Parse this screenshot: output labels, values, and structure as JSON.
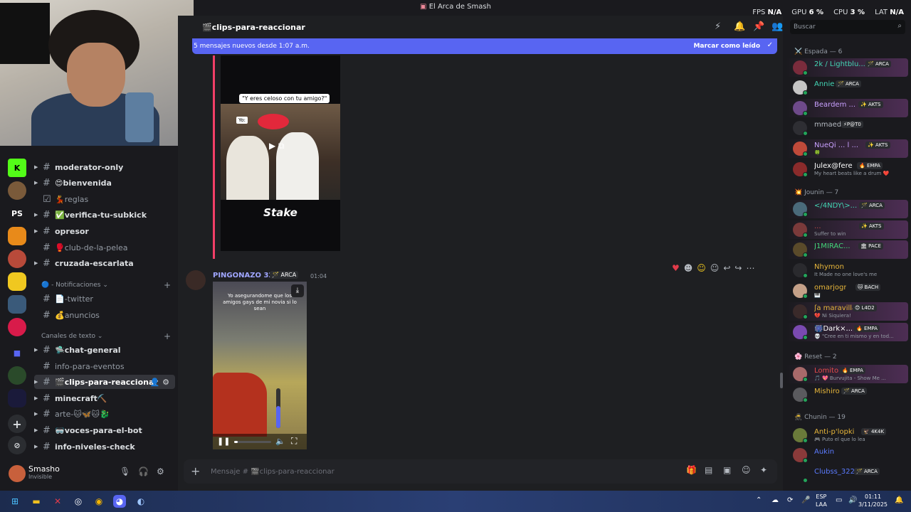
{
  "window": {
    "title": "El Arca de Smash",
    "title_icon": "server-icon"
  },
  "stats": {
    "fps_label": "FPS",
    "fps_value": "N/A",
    "gpu_label": "GPU",
    "gpu_value": "6 %",
    "cpu_label": "CPU",
    "cpu_value": "3 %",
    "lat_label": "LAT",
    "lat_value": "N/A"
  },
  "servers": [
    "K",
    "PS"
  ],
  "channels": [
    {
      "name": "moderator-only",
      "muted": false,
      "arrow": true
    },
    {
      "name": "😍bienvenida",
      "muted": false,
      "arrow": true
    },
    {
      "name": "💃reglas",
      "muted": true,
      "arrow": false,
      "icon": "rules"
    },
    {
      "name": "✅verifica-tu-subkick",
      "muted": false,
      "arrow": true
    },
    {
      "name": "opresor",
      "muted": false,
      "arrow": true
    },
    {
      "name": "🥊club-de-la-pelea",
      "muted": true,
      "arrow": false
    },
    {
      "name": "cruzada-escarlata",
      "muted": false,
      "arrow": true
    }
  ],
  "category_notifs": "🔵 - Notificaciones",
  "channels2": [
    {
      "name": "📄-twitter",
      "muted": true
    },
    {
      "name": "💰anuncios",
      "muted": true
    }
  ],
  "category_text": "Canales de texto",
  "channels3": [
    {
      "name": "🛸chat-general",
      "muted": false,
      "arrow": true
    },
    {
      "name": "info-para-eventos",
      "muted": true,
      "arrow": false
    },
    {
      "name": "🎬clips-para-reaccionar",
      "muted": false,
      "arrow": true,
      "selected": true
    },
    {
      "name": "minecraft⛏️",
      "muted": false,
      "arrow": true
    },
    {
      "name": "arte-🐱🦋🐱🐉",
      "muted": true,
      "arrow": true
    },
    {
      "name": "🥽voces-para-el-bot",
      "muted": false,
      "arrow": true
    },
    {
      "name": "info-niveles-check",
      "muted": false,
      "arrow": true
    }
  ],
  "user": {
    "name": "Smasho",
    "status": "Invisible"
  },
  "channel_header": {
    "name": "🎬clips-para-reaccionar"
  },
  "banner": {
    "text": "5 mensajes nuevos desde 1:07 a.m.",
    "action": "Marcar como leído"
  },
  "video1": {
    "caption": "\"Y eres celoso con tu amigo?\"",
    "yo": "Yo:",
    "brand": "Stake"
  },
  "message2": {
    "author": "PINGONAZO 322",
    "tag": "🪄 ARCA",
    "time": "01:04",
    "video_caption": "Yo asegurandome que los amigos gays de mi novia si lo sean",
    "progress": 0.1,
    "volume": 0.55
  },
  "composer": {
    "placeholder": "Mensaje # 🎬clips-para-reaccionar"
  },
  "search": {
    "placeholder": "Buscar"
  },
  "member_groups": [
    {
      "title": "⚔️ Espada — 6"
    },
    {
      "title": "💥 Jounin — 7"
    },
    {
      "title": "🌸 Reset — 2"
    },
    {
      "title": "🥷 Chunin — 19"
    }
  ],
  "members": [
    {
      "name": "2k / Lightblu...",
      "tag": "🪄 ARCA",
      "sub": "",
      "color": "#43d6b5",
      "av": "#7a2c3c",
      "hl": true
    },
    {
      "name": "Annie",
      "tag": "🪄 ARCA",
      "sub": "",
      "color": "#43d6b5",
      "av": "#c5c5c5",
      "hl": false
    },
    {
      "name": "Beardem ...",
      "tag": "✨ AKTS",
      "sub": "",
      "color": "#c9a0ff",
      "av": "#6e4a8a",
      "hl": true
    },
    {
      "name": "mmaed",
      "tag": "⚡P@T0",
      "sub": "",
      "color": "#b5bac1",
      "av": "#2e2e33",
      "hl": false
    },
    {
      "name": "NueQi ... l ...",
      "tag": "✨ AKTS",
      "sub": "🍀",
      "color": "#c9a0ff",
      "av": "#c04a3a",
      "hl": true
    },
    {
      "name": "Julex@fere",
      "tag": "🔥 EMPA",
      "sub": "My heart beats like a drum ❤️",
      "color": "#ffffff",
      "av": "#8a2b2b",
      "hl": false
    },
    {
      "name": "</4NDY\\>...",
      "tag": "🪄 ARCA",
      "sub": "",
      "color": "#43d6b5",
      "av": "#4a6a7a",
      "hl": true
    },
    {
      "name": "...",
      "tag": "✨ AKTS",
      "sub": "Suffer to win",
      "color": "#c24a4a",
      "av": "#7a3a3a",
      "hl": true
    },
    {
      "name": "J1MIRAC...",
      "tag": "🏛 PACE",
      "sub": "",
      "color": "#43d67a",
      "av": "#5a4a2a",
      "hl": true
    },
    {
      "name": "Nhymon",
      "tag": "",
      "sub": "It Made no one love's me",
      "color": "#e6b53a",
      "av": "#2a2a2e",
      "hl": false
    },
    {
      "name": "omarjogr",
      "tag": "🐱 BACH",
      "sub": "🎹",
      "color": "#e6b53a",
      "av": "#c4a088",
      "hl": false
    },
    {
      "name": "ʃa maravilla",
      "tag": "😊 L4D2",
      "sub": "💔 Ni Siquiera!",
      "color": "#e6b53a",
      "av": "#3a2a2a",
      "hl": true
    },
    {
      "name": "🎆Dark×...",
      "tag": "🔥 EMPA",
      "sub": "💀 \"Cree en ti mismo y en tod...",
      "color": "#ffffff",
      "av": "#7a4ab0",
      "hl": true
    },
    {
      "name": "Lomito",
      "tag": "🔥 EMPA",
      "sub": "🎵 💖 Burvujita - Show Me ...",
      "color": "#e64a4a",
      "av": "#a86a6a",
      "hl": true
    },
    {
      "name": "Mishiro",
      "tag": "🪄 ARCA",
      "sub": "",
      "color": "#e6b53a",
      "av": "#5a5a5e",
      "hl": false
    },
    {
      "name": "Anti-p'lopki",
      "tag": "🦅 4K4K",
      "sub": "🎮 Puto el que lo lea",
      "color": "#e6b53a",
      "av": "#6a7a3a",
      "hl": false
    },
    {
      "name": "Aukin",
      "tag": "",
      "sub": "",
      "color": "#5b7bff",
      "av": "#8a3a3a",
      "hl": false
    },
    {
      "name": "Clubss_322",
      "tag": "🪄 ARCA",
      "sub": "",
      "color": "#5b7bff",
      "av": "#1a1a1e",
      "hl": false
    }
  ],
  "taskbar": {
    "lang1": "ESP",
    "lang2": "LAA",
    "time": "01:11",
    "date": "3/11/2025"
  }
}
